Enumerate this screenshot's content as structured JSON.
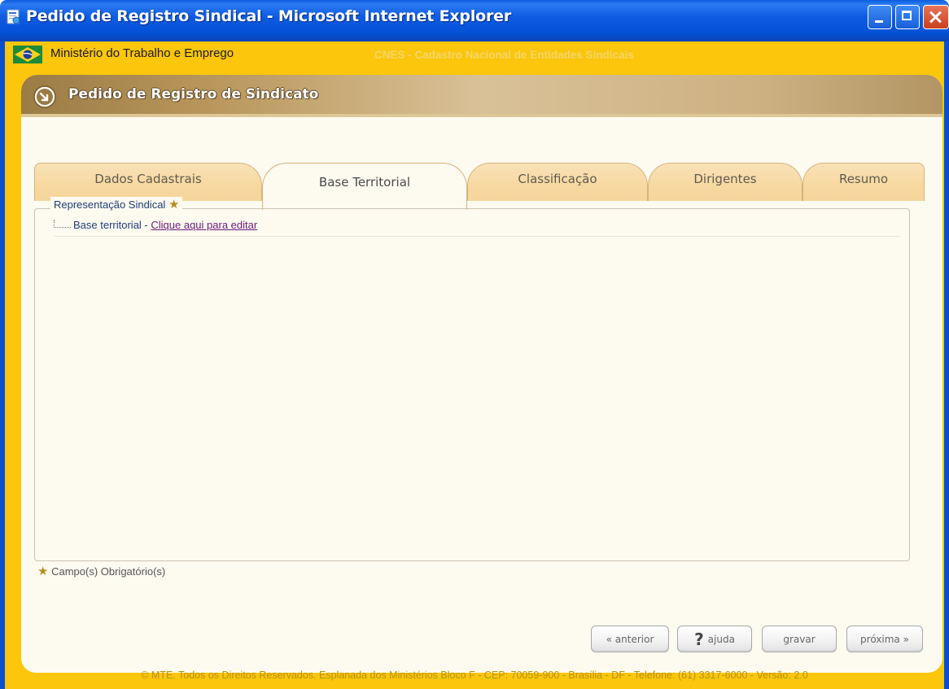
{
  "window": {
    "title": "Pedido de Registro Sindical - Microsoft Internet Explorer",
    "app_icon": "internet-explorer-page-icon",
    "controls": [
      "minimize",
      "maximize",
      "close"
    ]
  },
  "header": {
    "ministry": "Ministério do Trabalho e Emprego",
    "system": "CNES - Cadastro Nacional de Entidades Sindicais"
  },
  "page": {
    "title": "Pedido de Registro de Sindicato",
    "title_icon": "arrow-circle-icon"
  },
  "tabs": [
    {
      "label": "Dados Cadastrais",
      "active": false
    },
    {
      "label": "Base Territorial",
      "active": true
    },
    {
      "label": "Classificação",
      "active": false
    },
    {
      "label": "Dirigentes",
      "active": false
    },
    {
      "label": "Resumo",
      "active": false
    }
  ],
  "section": {
    "legend": "Representação Sindical",
    "required_marker": "★",
    "tree_item_label": "Base territorial - ",
    "tree_item_link": "Clique aqui para editar"
  },
  "required_note": "Campo(s) Obrigatório(s)",
  "buttons": {
    "anterior": "« anterior",
    "ajuda": "ajuda",
    "ajuda_icon": "?",
    "gravar": "gravar",
    "proxima": "próxima »"
  },
  "footer": "© MTE. Todos os Direitos Reservados. Esplanada dos Ministérios Bloco F - CEP: 70059-900 - Brasília - DF - Telefone: (61) 3317-6000 - Versão: 2.0",
  "colors": {
    "app_background": "#fbc60b",
    "titlebar": "#0553d8",
    "card": "#fdfaf0",
    "link": "#6b1a7a",
    "label_text": "#1f3d7a"
  }
}
